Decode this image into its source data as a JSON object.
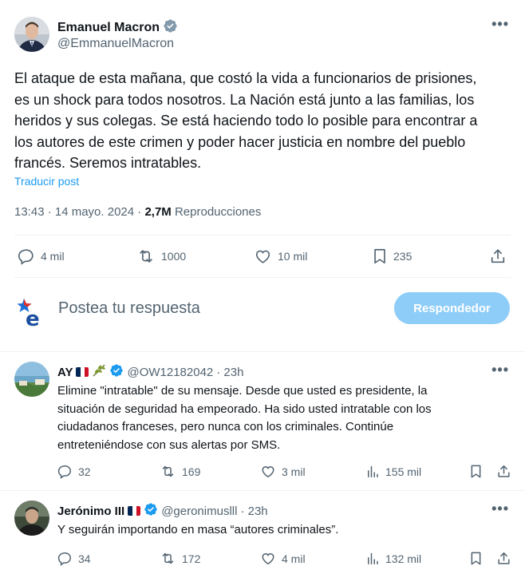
{
  "post": {
    "author_name": "Emanuel Macron",
    "author_handle": "@EmmanuelMacron",
    "text": "El ataque de esta mañana, que costó la vida a funcionarios de prisiones,\nes un shock para todos nosotros. La Nación está junto a las familias, los\nheridos y sus colegas. Se está haciendo todo lo posible para encontrar a\nlos autores de este crimen y poder hacer justicia en nombre del pueblo\nfrancés. Seremos intratables.",
    "translate_label": "Traducir post",
    "timestamp": "13:43 · 14 mayo. 2024 ·",
    "views_count": "2,7M",
    "views_label": "Reproducciones",
    "stats": {
      "replies": "4 mil",
      "reposts": "1000",
      "likes": "10 mil",
      "bookmarks": "235"
    }
  },
  "compose": {
    "placeholder": "Postea tu respuesta",
    "reply_button": "Respondedor"
  },
  "replies": [
    {
      "name": "AY",
      "handle": "@OW12182042",
      "time": "· 23h",
      "text": "Elimine \"intratable\" de su mensaje. Desde que usted es presidente, la\nsituación de seguridad ha empeorado. Ha sido usted intratable con los\nciudadanos franceses, pero nunca con los criminales. Continúe\nentreteniéndose con sus alertas por SMS.",
      "stats": {
        "replies": "32",
        "reposts": "169",
        "likes": "3 mil",
        "views": "155 mil"
      }
    },
    {
      "name": "Jerónimo III",
      "handle": "@geronimuslll",
      "time": "· 23h",
      "text": "Y seguirán importando en masa “autores criminales”.",
      "stats": {
        "replies": "34",
        "reposts": "172",
        "likes": "4 mil",
        "views": "132 mil"
      }
    }
  ],
  "colors": {
    "accent": "#1d9bf0",
    "reply_button": "#8ecdf8",
    "muted_text": "#536471",
    "divider": "#eff3f4"
  },
  "icons": [
    "verified-badge-icon",
    "more-icon",
    "reply-icon",
    "repost-icon",
    "like-icon",
    "bookmark-icon",
    "share-icon",
    "views-icon",
    "flag-france-icon",
    "olive-branch-icon"
  ]
}
